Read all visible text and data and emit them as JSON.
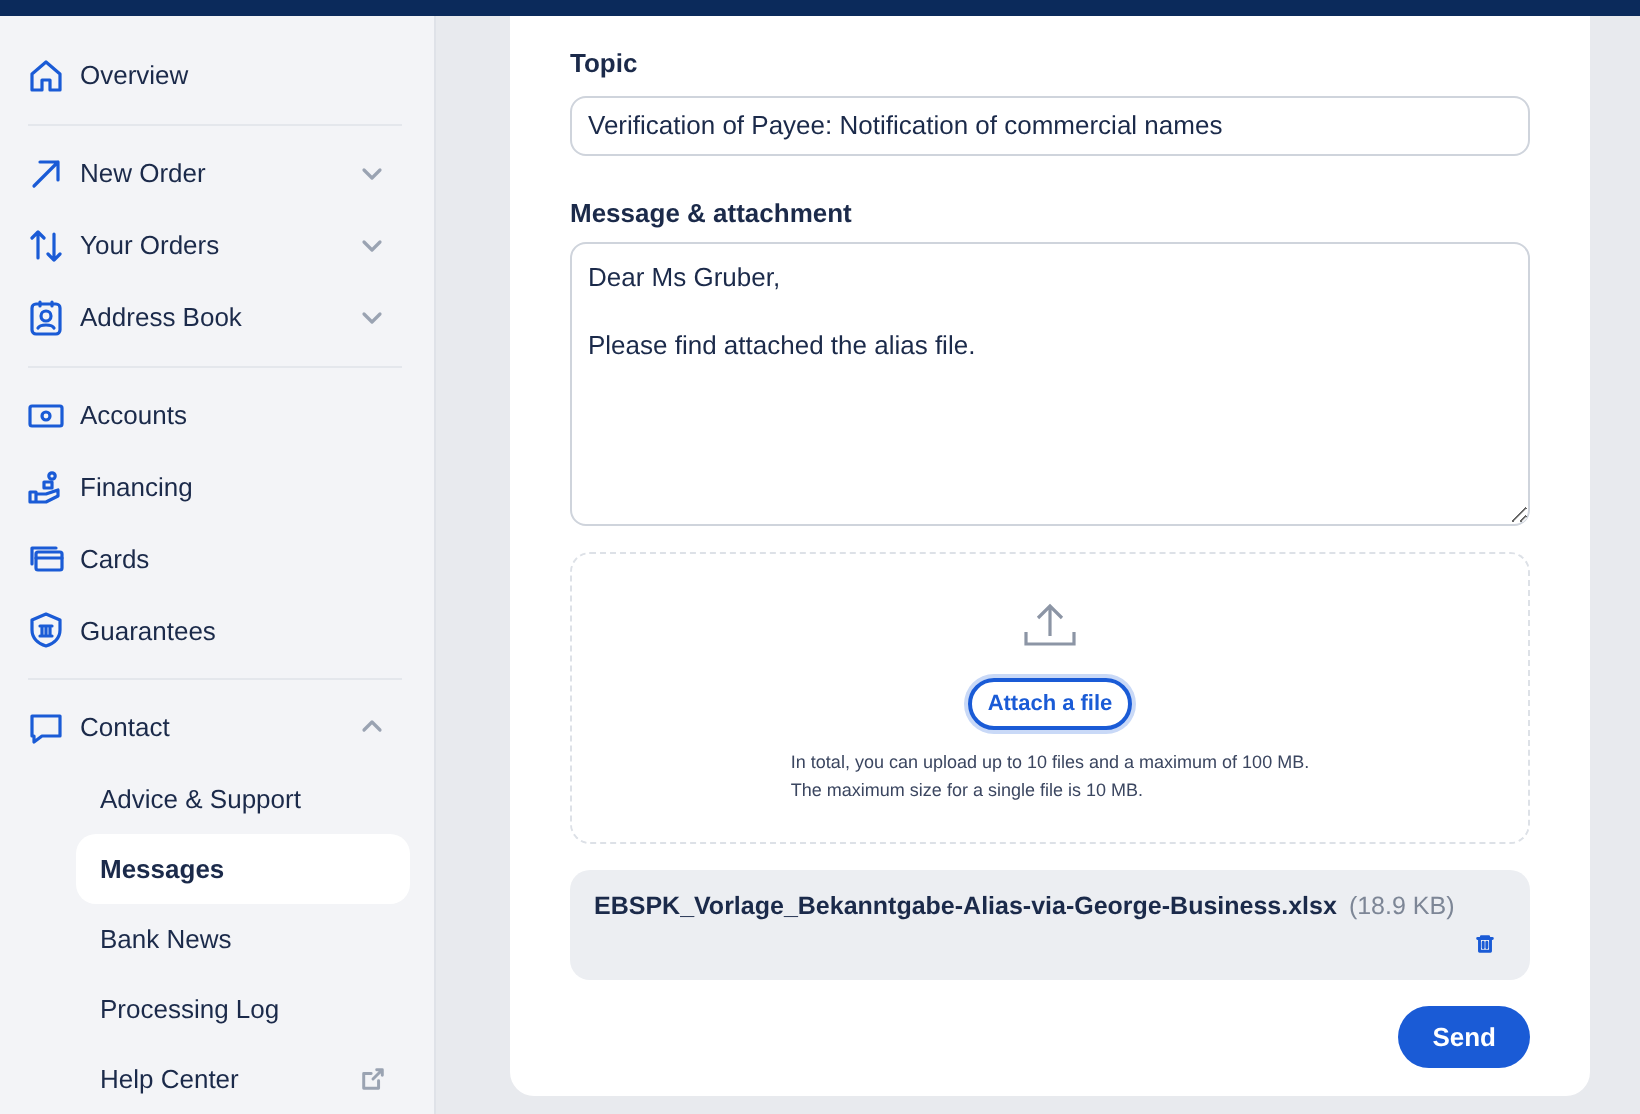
{
  "sidebar": {
    "sections": [
      [
        {
          "label": "Overview"
        }
      ],
      [
        {
          "label": "New Order",
          "expanded": false
        },
        {
          "label": "Your Orders",
          "expanded": false
        },
        {
          "label": "Address Book",
          "expanded": false
        }
      ],
      [
        {
          "label": "Accounts"
        },
        {
          "label": "Financing"
        },
        {
          "label": "Cards"
        },
        {
          "label": "Guarantees"
        }
      ],
      [
        {
          "label": "Contact",
          "expanded": true,
          "children": [
            {
              "label": "Advice & Support",
              "selected": false
            },
            {
              "label": "Messages",
              "selected": true
            },
            {
              "label": "Bank News",
              "selected": false
            },
            {
              "label": "Processing Log",
              "selected": false
            },
            {
              "label": "Help Center",
              "selected": false,
              "external": true
            }
          ]
        }
      ]
    ]
  },
  "form": {
    "topic": {
      "label": "Topic",
      "value": "Verification of Payee: Notification of commercial names"
    },
    "message": {
      "label": "Message & attachment",
      "value": "Dear Ms Gruber,\n\nPlease find attached the alias file."
    },
    "upload": {
      "button": "Attach a file",
      "hint": [
        "In total, you can upload up to 10 files and a maximum of 100 MB.",
        "The maximum size for a single file is 10 MB."
      ]
    },
    "attachments": [
      {
        "name": "EBSPK_Vorlage_Bekanntgabe-Alias-via-George-Business.xlsx",
        "size": "(18.9 KB)"
      }
    ],
    "send": "Send"
  }
}
